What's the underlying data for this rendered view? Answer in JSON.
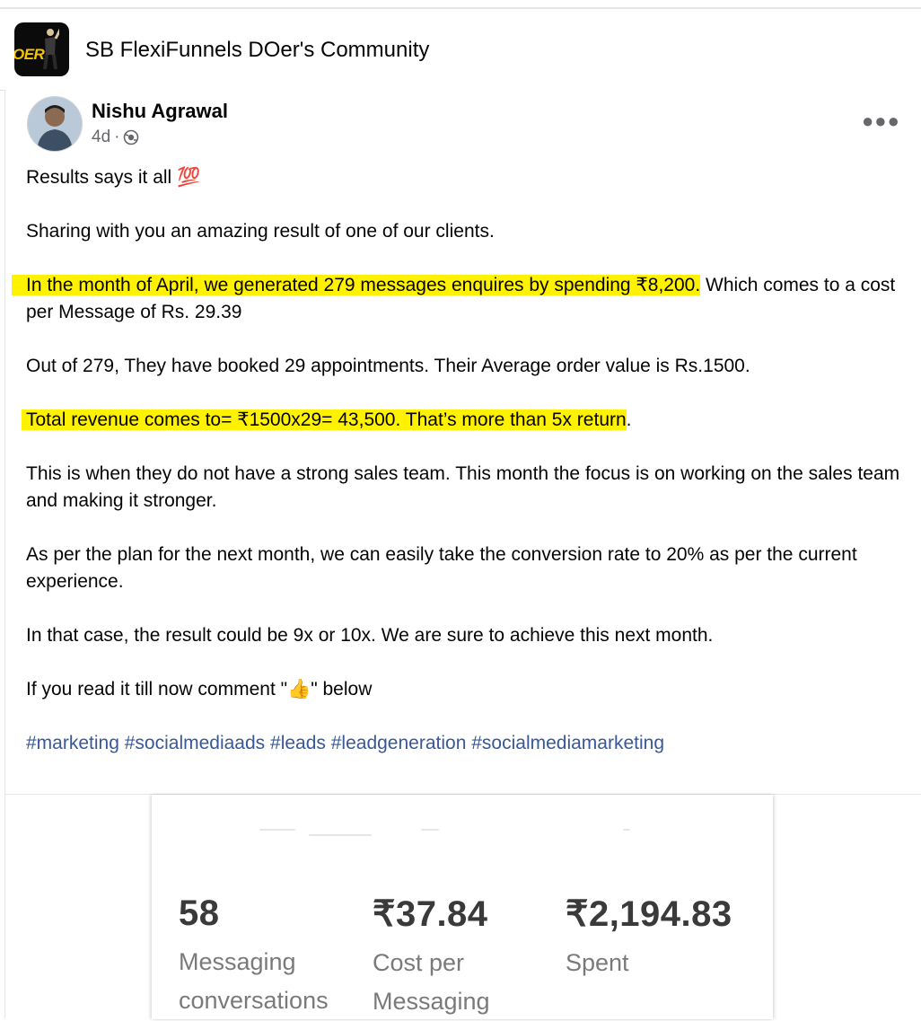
{
  "group": {
    "name": "SB FlexiFunnels DOer's Community",
    "logo_text": "OER"
  },
  "post": {
    "author": "Nishu Agrawal",
    "time": "4d",
    "privacy_icon": "globe-icon",
    "menu_icon": "more-icon",
    "paragraphs": {
      "p1": "Results says it all 💯",
      "p2": "Sharing with you an amazing result of one of our clients.",
      "p3_highlight": "In the month of April, we generated 279 messages enquires by spending ₹8,200.",
      "p3_rest": " Which comes to a cost per Message of Rs. 29.39",
      "p4": "Out of 279, They have booked 29 appointments. Their Average order value is Rs.1500.",
      "p5_highlight": "Total revenue comes to= ₹1500x29= 43,500. That’s more than 5x return",
      "p5_rest": ".",
      "p6": "This is when they do not have a strong sales team. This month the focus is on working on the sales team and making it stronger.",
      "p7": "As per the plan for the next month, we can easily take the conversion rate to 20% as per the current experience.",
      "p8": "In that case, the result could be 9x or 10x. We are sure to achieve this next month.",
      "p9": "If you read it till now comment \"👍\" below"
    },
    "hashtags": [
      "#marketing",
      "#socialmediaads",
      "#leads",
      "#leadgeneration",
      "#socialmediamarketing"
    ]
  },
  "media": {
    "metrics": [
      {
        "value": "58",
        "label_line1": "Messaging",
        "label_line2": "conversations"
      },
      {
        "value": "₹37.84",
        "label_line1": "Cost per",
        "label_line2": "Messaging"
      },
      {
        "value": "₹2,194.83",
        "label_line1": "Spent",
        "label_line2": ""
      }
    ]
  },
  "colors": {
    "highlight": "#fff200",
    "hashtag": "#385898",
    "logo_yellow": "#f5c400"
  }
}
